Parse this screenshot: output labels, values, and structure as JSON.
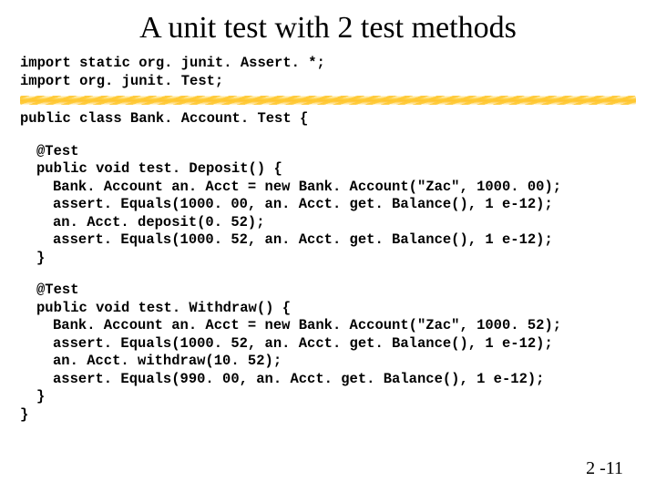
{
  "title": "A unit test with 2 test methods",
  "imports": {
    "line1": "import static org. junit. Assert. *;",
    "line2": "import org. junit. Test;"
  },
  "classDecl": "public class Bank. Account. Test {",
  "methods": [
    {
      "annotation": "@Test",
      "signature": "public void test. Deposit() {",
      "body": [
        "Bank. Account an. Acct = new Bank. Account(\"Zac\", 1000. 00);",
        "assert. Equals(1000. 00, an. Acct. get. Balance(), 1 e-12);",
        "an. Acct. deposit(0. 52);",
        "assert. Equals(1000. 52, an. Acct. get. Balance(), 1 e-12);"
      ],
      "close": "}"
    },
    {
      "annotation": "@Test",
      "signature": "public void test. Withdraw() {",
      "body": [
        "Bank. Account an. Acct = new Bank. Account(\"Zac\", 1000. 52);",
        "assert. Equals(1000. 52, an. Acct. get. Balance(), 1 e-12);",
        "an. Acct. withdraw(10. 52);",
        "assert. Equals(990. 00, an. Acct. get. Balance(), 1 e-12);"
      ],
      "close": "}"
    }
  ],
  "classClose": "}",
  "pageNumber": "2 -11"
}
